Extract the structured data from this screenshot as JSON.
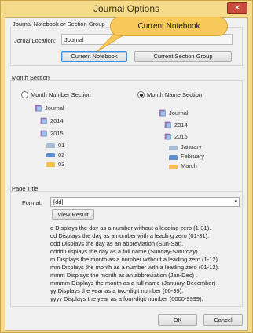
{
  "window": {
    "title": "Journal Options",
    "close_glyph": "✕"
  },
  "callout": {
    "text": "Current Notebook"
  },
  "notebook_group": {
    "label": "Journal Notebook or Section Group",
    "location_label": "Jornal Location:",
    "location_value": "Journal",
    "current_notebook_button": "Current Notebook",
    "current_section_group_button": "Current Section Group"
  },
  "month_section": {
    "label": "Month Section",
    "option_number": {
      "label": "Month Number Section",
      "selected": false
    },
    "option_name": {
      "label": "Month Name Section",
      "selected": true
    },
    "number_tree": {
      "notebook": "Journal",
      "year1": "2014",
      "year2": "2015",
      "sections": [
        "01",
        "02",
        "03"
      ]
    },
    "name_tree": {
      "notebook": "Journal",
      "year1": "2014",
      "year2": "2015",
      "sections": [
        "January",
        "February",
        "March"
      ]
    },
    "section_colors": [
      "#a9bcd6",
      "#5c8ed0",
      "#f4c04a"
    ]
  },
  "page_title": {
    "label": "Page Title",
    "format_label": "Format:",
    "format_value": "[dd]",
    "view_result_button": "View Result",
    "help_lines": [
      "d     Displays the day as a number without a leading zero (1-31).",
      "dd    Displays the day as a number with a leading zero (01-31).",
      "ddd   Displays the day as an abbreviation (Sun-Sat).",
      "dddd  Displays the day as a full name (Sunday-Saturday).",
      "m      Displays the month as a number without a leading zero (1-12).",
      "mm    Displays the month as a number with a leading zero (01-12).",
      "mmm   Displays the month as an abbreviation (Jan-Dec) .",
      "mmmm  Displays the month as a full name (January-December) .",
      "yy     Displays the year as a two-digit number (00-99).",
      "yyyy  Displays the year as a four-digit number (0000-9999)."
    ]
  },
  "footer": {
    "ok_button": "OK",
    "cancel_button": "Cancel"
  }
}
